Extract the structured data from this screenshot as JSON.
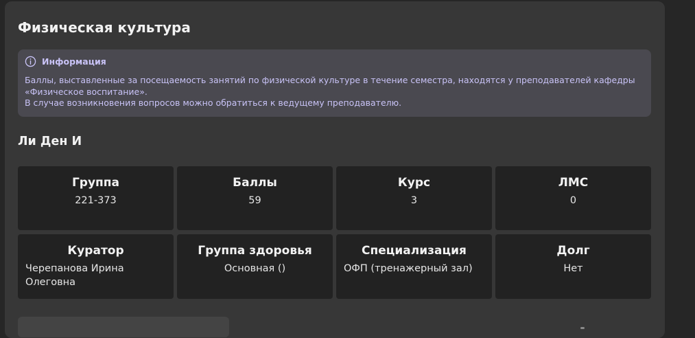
{
  "page": {
    "title": "Физическая культура"
  },
  "info": {
    "icon": "info-circle-icon",
    "title": "Информация",
    "lines": [
      "Баллы, выставленные за посещаемость занятий по физической культуре в течение семестра, находятся у преподавателей кафедры «Физическое воспитание».",
      "В случае возникновения вопросов можно обратиться к ведущему преподавателю."
    ],
    "accent_color": "#c9c3f7"
  },
  "student": {
    "name": "Ли Ден И"
  },
  "stats": [
    {
      "label": "Группа",
      "value": "221-373"
    },
    {
      "label": "Баллы",
      "value": "59"
    },
    {
      "label": "Курс",
      "value": "3"
    },
    {
      "label": "ЛМС",
      "value": "0"
    },
    {
      "label": "Куратор",
      "value": "Черепанова Ирина Олеговна"
    },
    {
      "label": "Группа здоровья",
      "value": "Основная ()"
    },
    {
      "label": "Специализация",
      "value": "ОФП (тренажерный зал)"
    },
    {
      "label": "Долг",
      "value": "Нет"
    }
  ]
}
